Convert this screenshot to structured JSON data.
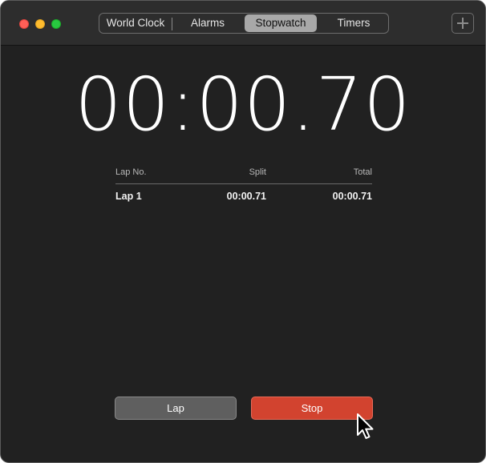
{
  "window": {
    "tabs": [
      {
        "label": "World Clock",
        "selected": false
      },
      {
        "label": "Alarms",
        "selected": false
      },
      {
        "label": "Stopwatch",
        "selected": true
      },
      {
        "label": "Timers",
        "selected": false
      }
    ],
    "add_icon": "plus-icon"
  },
  "stopwatch": {
    "display": "00:00.70"
  },
  "laps": {
    "headers": {
      "lap_no": "Lap No.",
      "split": "Split",
      "total": "Total"
    },
    "rows": [
      {
        "lap": "Lap 1",
        "split": "00:00.71",
        "total": "00:00.71"
      }
    ]
  },
  "buttons": {
    "lap_label": "Lap",
    "stop_label": "Stop"
  },
  "colors": {
    "window_background": "#212121",
    "titlebar_background": "#2d2d2d",
    "stop_button": "#d2432f",
    "lap_button": "#5f5f5f",
    "traffic_close": "#fe5f57",
    "traffic_minimize": "#febc2e",
    "traffic_zoom": "#28c840"
  }
}
